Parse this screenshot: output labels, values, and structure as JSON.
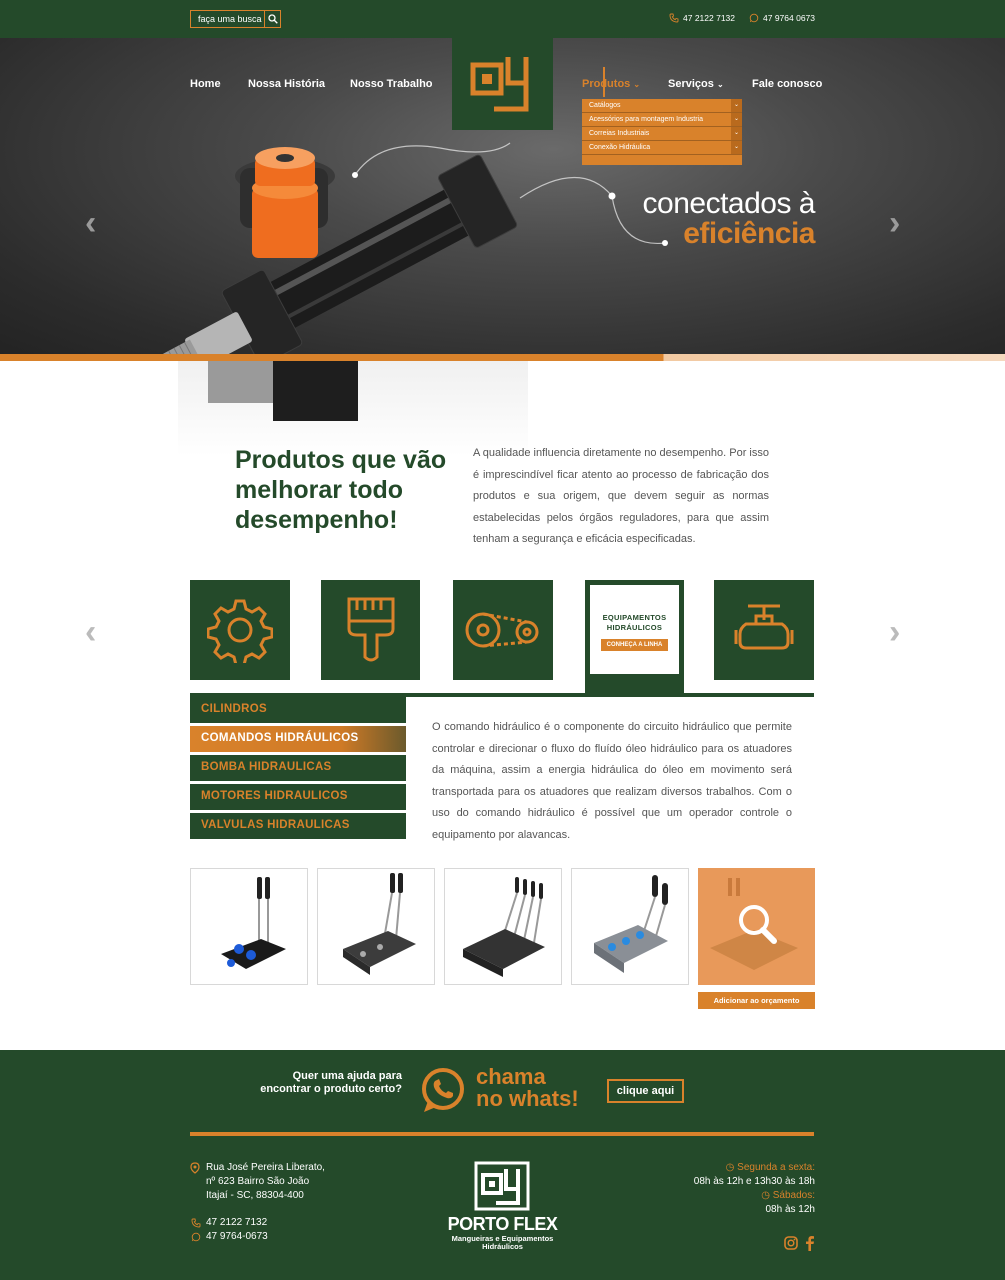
{
  "topbar": {
    "search_placeholder": "faça uma busca",
    "phone1": "47 2122 7132",
    "phone2": "47 9764 0673"
  },
  "nav": {
    "home": "Home",
    "historia": "Nossa História",
    "trabalho": "Nosso Trabalho",
    "produtos": "Produtos",
    "servicos": "Serviços",
    "contato": "Fale conosco"
  },
  "dropdown": {
    "items": [
      "Catálogos",
      "Acessórios para montagem Industria",
      "Correias Industriais",
      "Conexão Hidráulica"
    ]
  },
  "hero": {
    "line1": "conectados à",
    "line2": "eficiência"
  },
  "intro": {
    "title": "Produtos que vão melhorar todo desempenho!",
    "text": "A qualidade influencia diretamente no desempenho. Por isso é imprescindível ficar atento ao processo de fabricação dos produtos e sua origem, que devem seguir as normas estabelecidas pelos órgãos reguladores, para que assim tenham a segurança e eficácia especificadas."
  },
  "categories": {
    "active_title": "EQUIPAMENTOS HIDRÁULICOS",
    "active_cta": "CONHEÇA A LINHA"
  },
  "side_menu": [
    "CILINDROS",
    "COMANDOS HIDRÁULICOS",
    "BOMBA HIDRAULICAS",
    "MOTORES HIDRAULICOS",
    "VALVULAS HIDRAULICAS"
  ],
  "description": "O comando hidráulico é o componente do circuito hidráulico que permite controlar e direcionar o fluxo do fluído óleo hidráulico para os atuadores da máquina, assim a energia hidráulica do óleo em movimento será transportada para os atuadores que realizam diversos trabalhos. Com o uso do comando hidráulico é possível que um operador controle o equipamento por alavancas.",
  "products": {
    "add_label": "Adicionar ao orçamento"
  },
  "footer": {
    "help": "Quer uma ajuda para encontrar o produto certo?",
    "chama1": "chama",
    "chama2": "no whats!",
    "clique": "clique aqui",
    "addr1": "Rua José Pereira Liberato,",
    "addr2": "nº 623 Bairro São João",
    "addr3": "Itajaí - SC, 88304-400",
    "phone1": "47 2122 7132",
    "phone2": "47 9764-0673",
    "brand": "PORTO FLEX",
    "brand_sub1": "Mangueiras e Equipamentos",
    "brand_sub2": "Hidráulicos",
    "hours_label1": "Segunda a sexta:",
    "hours1": "08h às 12h e 13h30 às 18h",
    "hours_label2": "Sábados:",
    "hours2": "08h às 12h"
  },
  "colors": {
    "green": "#244a2a",
    "orange": "#d9822b"
  }
}
